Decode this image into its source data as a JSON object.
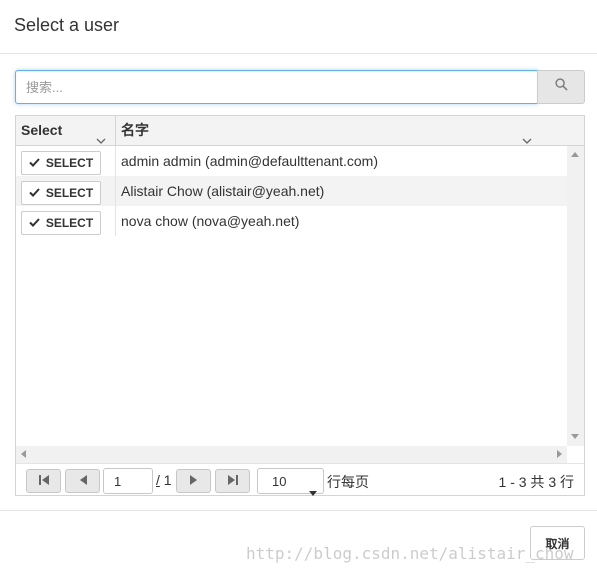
{
  "dialog": {
    "title": "Select a user"
  },
  "search": {
    "placeholder": "搜索...",
    "value": ""
  },
  "grid": {
    "columns": [
      "Select",
      "名字"
    ],
    "select_label": "SELECT",
    "rows": [
      {
        "name": "admin admin (admin@defaulttenant.com)"
      },
      {
        "name": "Alistair Chow (alistair@yeah.net)"
      },
      {
        "name": "nova chow (nova@yeah.net)"
      }
    ]
  },
  "pager": {
    "current_page": "1",
    "separator": "/",
    "total_pages": "1",
    "page_size": "10",
    "per_page_label": "行每页",
    "count_text": "1 - 3 共 3 行"
  },
  "footer": {
    "cancel_label": "取消"
  },
  "watermark": "http://blog.csdn.net/alistair_chow",
  "colors": {
    "focus": "#66afe9",
    "header_bg": "#f3f3f3",
    "alt_row": "#f3f3f3"
  },
  "icons": [
    "search-icon",
    "chevron-down-icon",
    "check-icon",
    "first-page-icon",
    "prev-page-icon",
    "next-page-icon",
    "last-page-icon",
    "dropdown-caret-icon"
  ]
}
